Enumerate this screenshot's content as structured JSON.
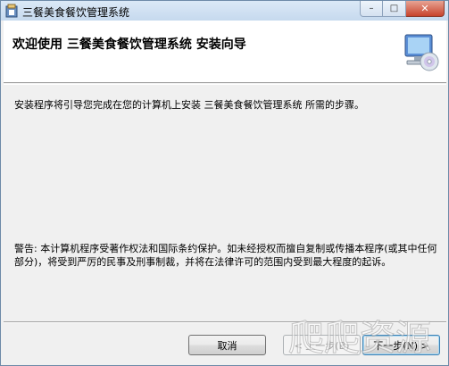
{
  "window": {
    "title": "三餐美食餐饮管理系统",
    "caption_buttons": {
      "minimize": "–",
      "maximize": "□",
      "close": "✕"
    }
  },
  "banner": {
    "title": "欢迎使用  三餐美食餐饮管理系统  安装向导",
    "icon": "computer-cd-icon"
  },
  "content": {
    "intro": "安装程序将引导您完成在您的计算机上安装 三餐美食餐饮管理系统 所需的步骤。",
    "warning": "警告: 本计算机程序受著作权法和国际条约保护。如未经授权而擅自复制或传播本程序(或其中任何部分)，将受到严厉的民事及刑事制裁，并将在法律许可的范围内受到最大程度的起诉。"
  },
  "buttons": {
    "cancel": "取消",
    "back": "< 上一步(B)",
    "next": "下一步(N) >"
  },
  "watermark": {
    "text": "爬爬资源"
  }
}
